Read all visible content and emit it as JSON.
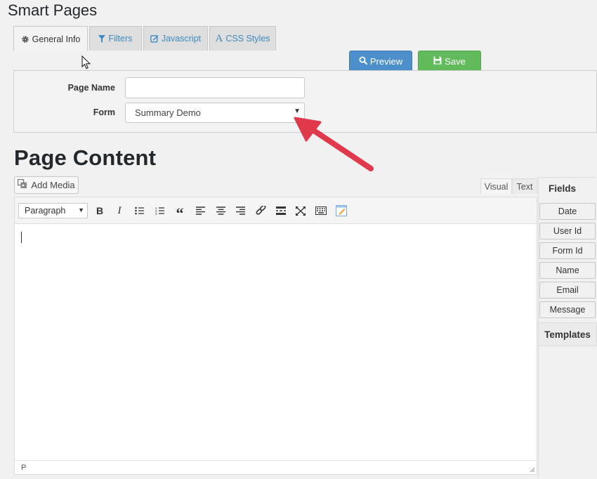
{
  "app": {
    "title": "Smart Pages"
  },
  "tabs": [
    {
      "label": "General Info",
      "icon": "gear-icon",
      "active": true
    },
    {
      "label": "Filters",
      "icon": "filter-icon",
      "active": false
    },
    {
      "label": "Javascript",
      "icon": "edit-icon",
      "active": false
    },
    {
      "label": "CSS Styles",
      "icon": "font-icon",
      "active": false
    }
  ],
  "actions": {
    "preview_label": "Preview",
    "save_label": "Save"
  },
  "form": {
    "page_name_label": "Page Name",
    "page_name_value": "",
    "form_label": "Form",
    "form_value": "Summary Demo"
  },
  "content": {
    "title": "Page Content",
    "add_media_label": "Add Media",
    "mode_visual": "Visual",
    "mode_text": "Text",
    "format_value": "Paragraph",
    "status_path": "P"
  },
  "fields": {
    "title": "Fields",
    "items": [
      "Date",
      "User Id",
      "Form Id",
      "Name",
      "Email",
      "Message"
    ]
  },
  "templates": {
    "title": "Templates"
  },
  "colors": {
    "preview": "#4c8fcb",
    "save": "#62bb5a",
    "tab_link": "#3e8ac0",
    "arrow": "#e0394b"
  }
}
